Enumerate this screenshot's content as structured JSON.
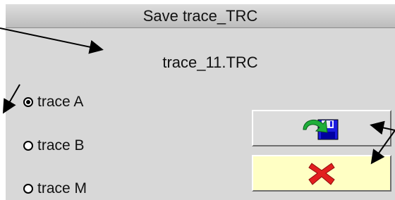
{
  "dialog": {
    "title": "Save trace_TRC",
    "filename": "trace_11.TRC",
    "radios": [
      {
        "label": "trace A",
        "checked": true
      },
      {
        "label": "trace B",
        "checked": false
      },
      {
        "label": "trace M",
        "checked": false
      }
    ],
    "buttons": {
      "save_icon": "save-icon",
      "cancel_icon": "cancel-icon",
      "cancel_bg": "#ffffc4"
    }
  }
}
